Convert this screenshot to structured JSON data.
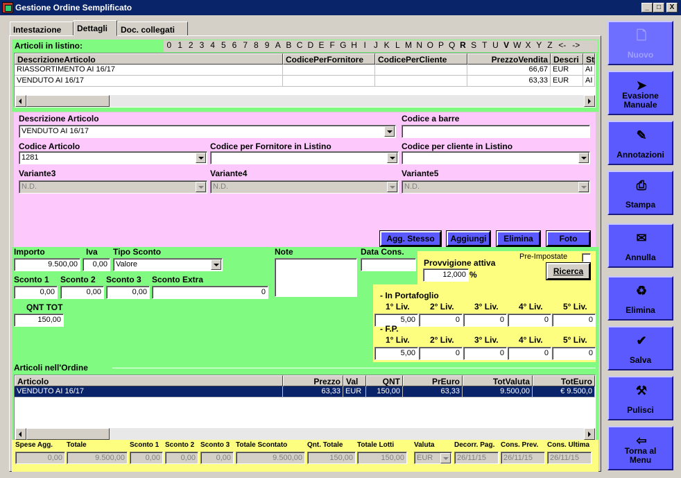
{
  "window": {
    "title": "Gestione Ordine Semplificato",
    "min": "_",
    "max": "□",
    "close": "X"
  },
  "tabs": [
    "Intestazione",
    "Dettagli",
    "Doc. collegati"
  ],
  "listino": {
    "label": "Articoli in listino:",
    "letters": [
      "0",
      "1",
      "2",
      "3",
      "4",
      "5",
      "6",
      "7",
      "8",
      "9",
      "A",
      "B",
      "C",
      "D",
      "E",
      "F",
      "G",
      "H",
      "I",
      "J",
      "K",
      "L",
      "M",
      "N",
      "O",
      "P",
      "Q",
      "R",
      "S",
      "T",
      "U",
      "V",
      "W",
      "X",
      "Y",
      "Z",
      "<-",
      "->"
    ],
    "columns": [
      "DescrizioneArticolo",
      "CodicePerFornitore",
      "CodicePerCliente",
      "PrezzoVendita",
      "Descri",
      "St"
    ],
    "rows": [
      [
        "RIASSORTIMENTO AI 16/17",
        "",
        "",
        "66,67",
        "EUR",
        "AI"
      ],
      [
        "VENDUTO AI 16/17",
        "",
        "",
        "63,33",
        "EUR",
        "AI"
      ]
    ]
  },
  "form": {
    "descrizione": {
      "label": "Descrizione Articolo",
      "value": "VENDUTO AI 16/17"
    },
    "barre": {
      "label": "Codice a barre",
      "value": ""
    },
    "codice": {
      "label": "Codice Articolo",
      "value": "1281"
    },
    "fornitore": {
      "label": "Codice per Fornitore in Listino",
      "value": ""
    },
    "cliente": {
      "label": "Codice per cliente in Listino",
      "value": ""
    },
    "v3": {
      "label": "Variante3",
      "value": "N.D."
    },
    "v4": {
      "label": "Variante4",
      "value": "N.D."
    },
    "v5": {
      "label": "Variante5",
      "value": "N.D."
    },
    "buttons": [
      "Agg. Stesso",
      "Aggiungi",
      "Elimina",
      "Foto"
    ]
  },
  "prices": {
    "importo_l": "Importo",
    "importo": "9.500,00",
    "iva_l": "Iva",
    "iva": "0,00",
    "tipo_l": "Tipo Sconto",
    "tipo": "Valore",
    "s1_l": "Sconto 1",
    "s1": "0,00",
    "s2_l": "Sconto 2",
    "s2": "0,00",
    "s3_l": "Sconto 3",
    "s3": "0,00",
    "sx_l": "Sconto Extra",
    "sx": "0",
    "qnt_l": "QNT TOT",
    "qnt": "150,00",
    "note_l": "Note",
    "data_l": "Data Cons.",
    "data": ""
  },
  "provv": {
    "label": "Provvigione attiva",
    "value": "12,000",
    "pct": "%",
    "pre": "Pre-Impostate",
    "ricerca": "Ricerca",
    "portafoglio": "- In Portafoglio",
    "fp": "- F.P.",
    "levels": [
      "1° Liv.",
      "2° Liv.",
      "3° Liv.",
      "4° Liv.",
      "5° Liv."
    ],
    "pvals": [
      "5,00",
      "0",
      "0",
      "0",
      "0"
    ],
    "fvals": [
      "5,00",
      "0",
      "0",
      "0",
      "0"
    ]
  },
  "ordine": {
    "label": "Articoli nell'Ordine",
    "columns": [
      "Articolo",
      "Prezzo",
      "Val",
      "QNT",
      "PrEuro",
      "TotValuta",
      "TotEuro"
    ],
    "rows": [
      [
        "VENDUTO AI 16/17",
        "63,33",
        "EUR",
        "150,00",
        "63,33",
        "9.500,00",
        "€ 9.500,0"
      ]
    ]
  },
  "totali": {
    "labels": [
      "Spese Agg.",
      "Totale",
      "Sconto 1",
      "Sconto 2",
      "Sconto 3",
      "Totale Scontato",
      "Qnt. Totale",
      "Totale Lotti",
      "Valuta",
      "Decorr. Pag.",
      "Cons. Prev.",
      "Cons. Ultima"
    ],
    "values": [
      "0,00",
      "9.500,00",
      "0,00",
      "0,00",
      "0,00",
      "9.500,00",
      "150,00",
      "150,00",
      "EUR",
      "26/11/15",
      "26/11/15",
      "26/11/15"
    ]
  },
  "side": [
    {
      "label": "Nuovo",
      "icon": "new-document-icon",
      "glyph": "🗋"
    },
    {
      "label": "Evasione Manuale",
      "icon": "cursor-icon",
      "glyph": "➤"
    },
    {
      "label": "Annotazioni",
      "icon": "notepad-icon",
      "glyph": "✎"
    },
    {
      "label": "Stampa",
      "icon": "printer-icon",
      "glyph": "⎙"
    },
    {
      "label": "Annulla",
      "icon": "cancel-icon",
      "glyph": "✉"
    },
    {
      "label": "Elimina",
      "icon": "trash-icon",
      "glyph": "♻"
    },
    {
      "label": "Salva",
      "icon": "checkmark-icon",
      "glyph": "✔"
    },
    {
      "label": "Pulisci",
      "icon": "broom-icon",
      "glyph": "⚒"
    },
    {
      "label": "Torna al Menu",
      "icon": "exit-door-icon",
      "glyph": "⇦"
    }
  ]
}
